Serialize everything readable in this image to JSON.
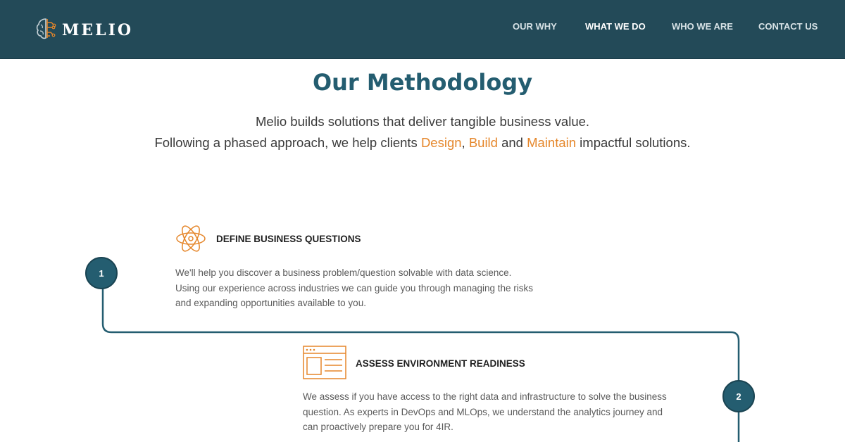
{
  "header": {
    "brand": "MELIO",
    "logo_icon": "brain-icon",
    "nav": [
      {
        "label": "OUR WHY",
        "active": false
      },
      {
        "label": "WHAT WE DO",
        "active": true
      },
      {
        "label": "WHO WE ARE",
        "active": false
      },
      {
        "label": "CONTACT US",
        "active": false
      }
    ]
  },
  "main": {
    "title": "Our Methodology",
    "intro_line1": "Melio builds solutions that deliver tangible business value.",
    "intro_line2_prefix": "Following a phased approach, we help clients ",
    "intro_design": "Design",
    "intro_comma": ",",
    "intro_build": "Build",
    "intro_and": " and ",
    "intro_maintain": "Maintain",
    "intro_suffix": " impactful solutions."
  },
  "steps": [
    {
      "number": "1",
      "icon": "atom-icon",
      "heading": "DEFINE BUSINESS QUESTIONS",
      "text": "We'll help you discover a business problem/question solvable with data science. Using our experience across industries we can guide you through managing the risks and expanding opportunities available to you."
    },
    {
      "number": "2",
      "icon": "browser-window-icon",
      "heading": "ASSESS ENVIRONMENT READINESS",
      "text": "We assess if you have access to the right data and infrastructure to solve the business question. As experts in DevOps and MLOps, we understand the analytics journey and can proactively prepare you for 4IR."
    }
  ],
  "colors": {
    "header_bg": "#234a58",
    "accent_teal": "#245d70",
    "accent_orange": "#e5862a"
  }
}
